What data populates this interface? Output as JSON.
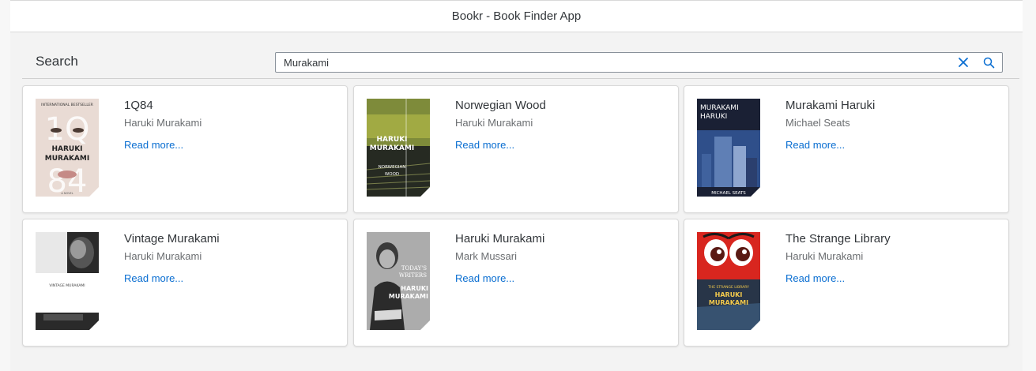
{
  "app": {
    "title": "Bookr - Book Finder App"
  },
  "search": {
    "label": "Search",
    "value": "Murakami",
    "clear_icon": "close-icon",
    "search_icon": "search-icon"
  },
  "colors": {
    "accent": "#0a6ed1",
    "text": "#32363a",
    "muted": "#6a6d70",
    "background": "#f3f3f3"
  },
  "books": [
    {
      "title": "1Q84",
      "author": "Haruki Murakami",
      "link": "Read more...",
      "cover_texts": [
        "INTERNATIONAL BESTSELLER",
        "HARUKI",
        "MURAKAMI",
        "A NOVEL"
      ],
      "cover_art": "1q84"
    },
    {
      "title": "Norwegian Wood",
      "author": "Haruki Murakami",
      "link": "Read more...",
      "cover_texts": [
        "HARUKI",
        "MURAKAMI",
        "NORWEGIAN",
        "WOOD"
      ],
      "cover_art": "norwegian-wood"
    },
    {
      "title": "Murakami Haruki",
      "author": "Michael Seats",
      "link": "Read more...",
      "cover_texts": [
        "MURAKAMI",
        "HARUKI",
        "MICHAEL SEATS"
      ],
      "cover_art": "murakami-haruki"
    },
    {
      "title": "Vintage Murakami",
      "author": "Haruki Murakami",
      "link": "Read more...",
      "cover_texts": [
        "VINTAGE MURAKAMI"
      ],
      "cover_art": "vintage"
    },
    {
      "title": "Haruki Murakami",
      "author": "Mark Mussari",
      "link": "Read more...",
      "cover_texts": [
        "TODAY'S",
        "WRITERS",
        "HARUKI",
        "MURAKAMI"
      ],
      "cover_art": "todays-writers"
    },
    {
      "title": "The Strange Library",
      "author": "Haruki Murakami",
      "link": "Read more...",
      "cover_texts": [
        "THE STRANGE LIBRARY",
        "HARUKI",
        "MURAKAMI"
      ],
      "cover_art": "strange-library"
    }
  ]
}
